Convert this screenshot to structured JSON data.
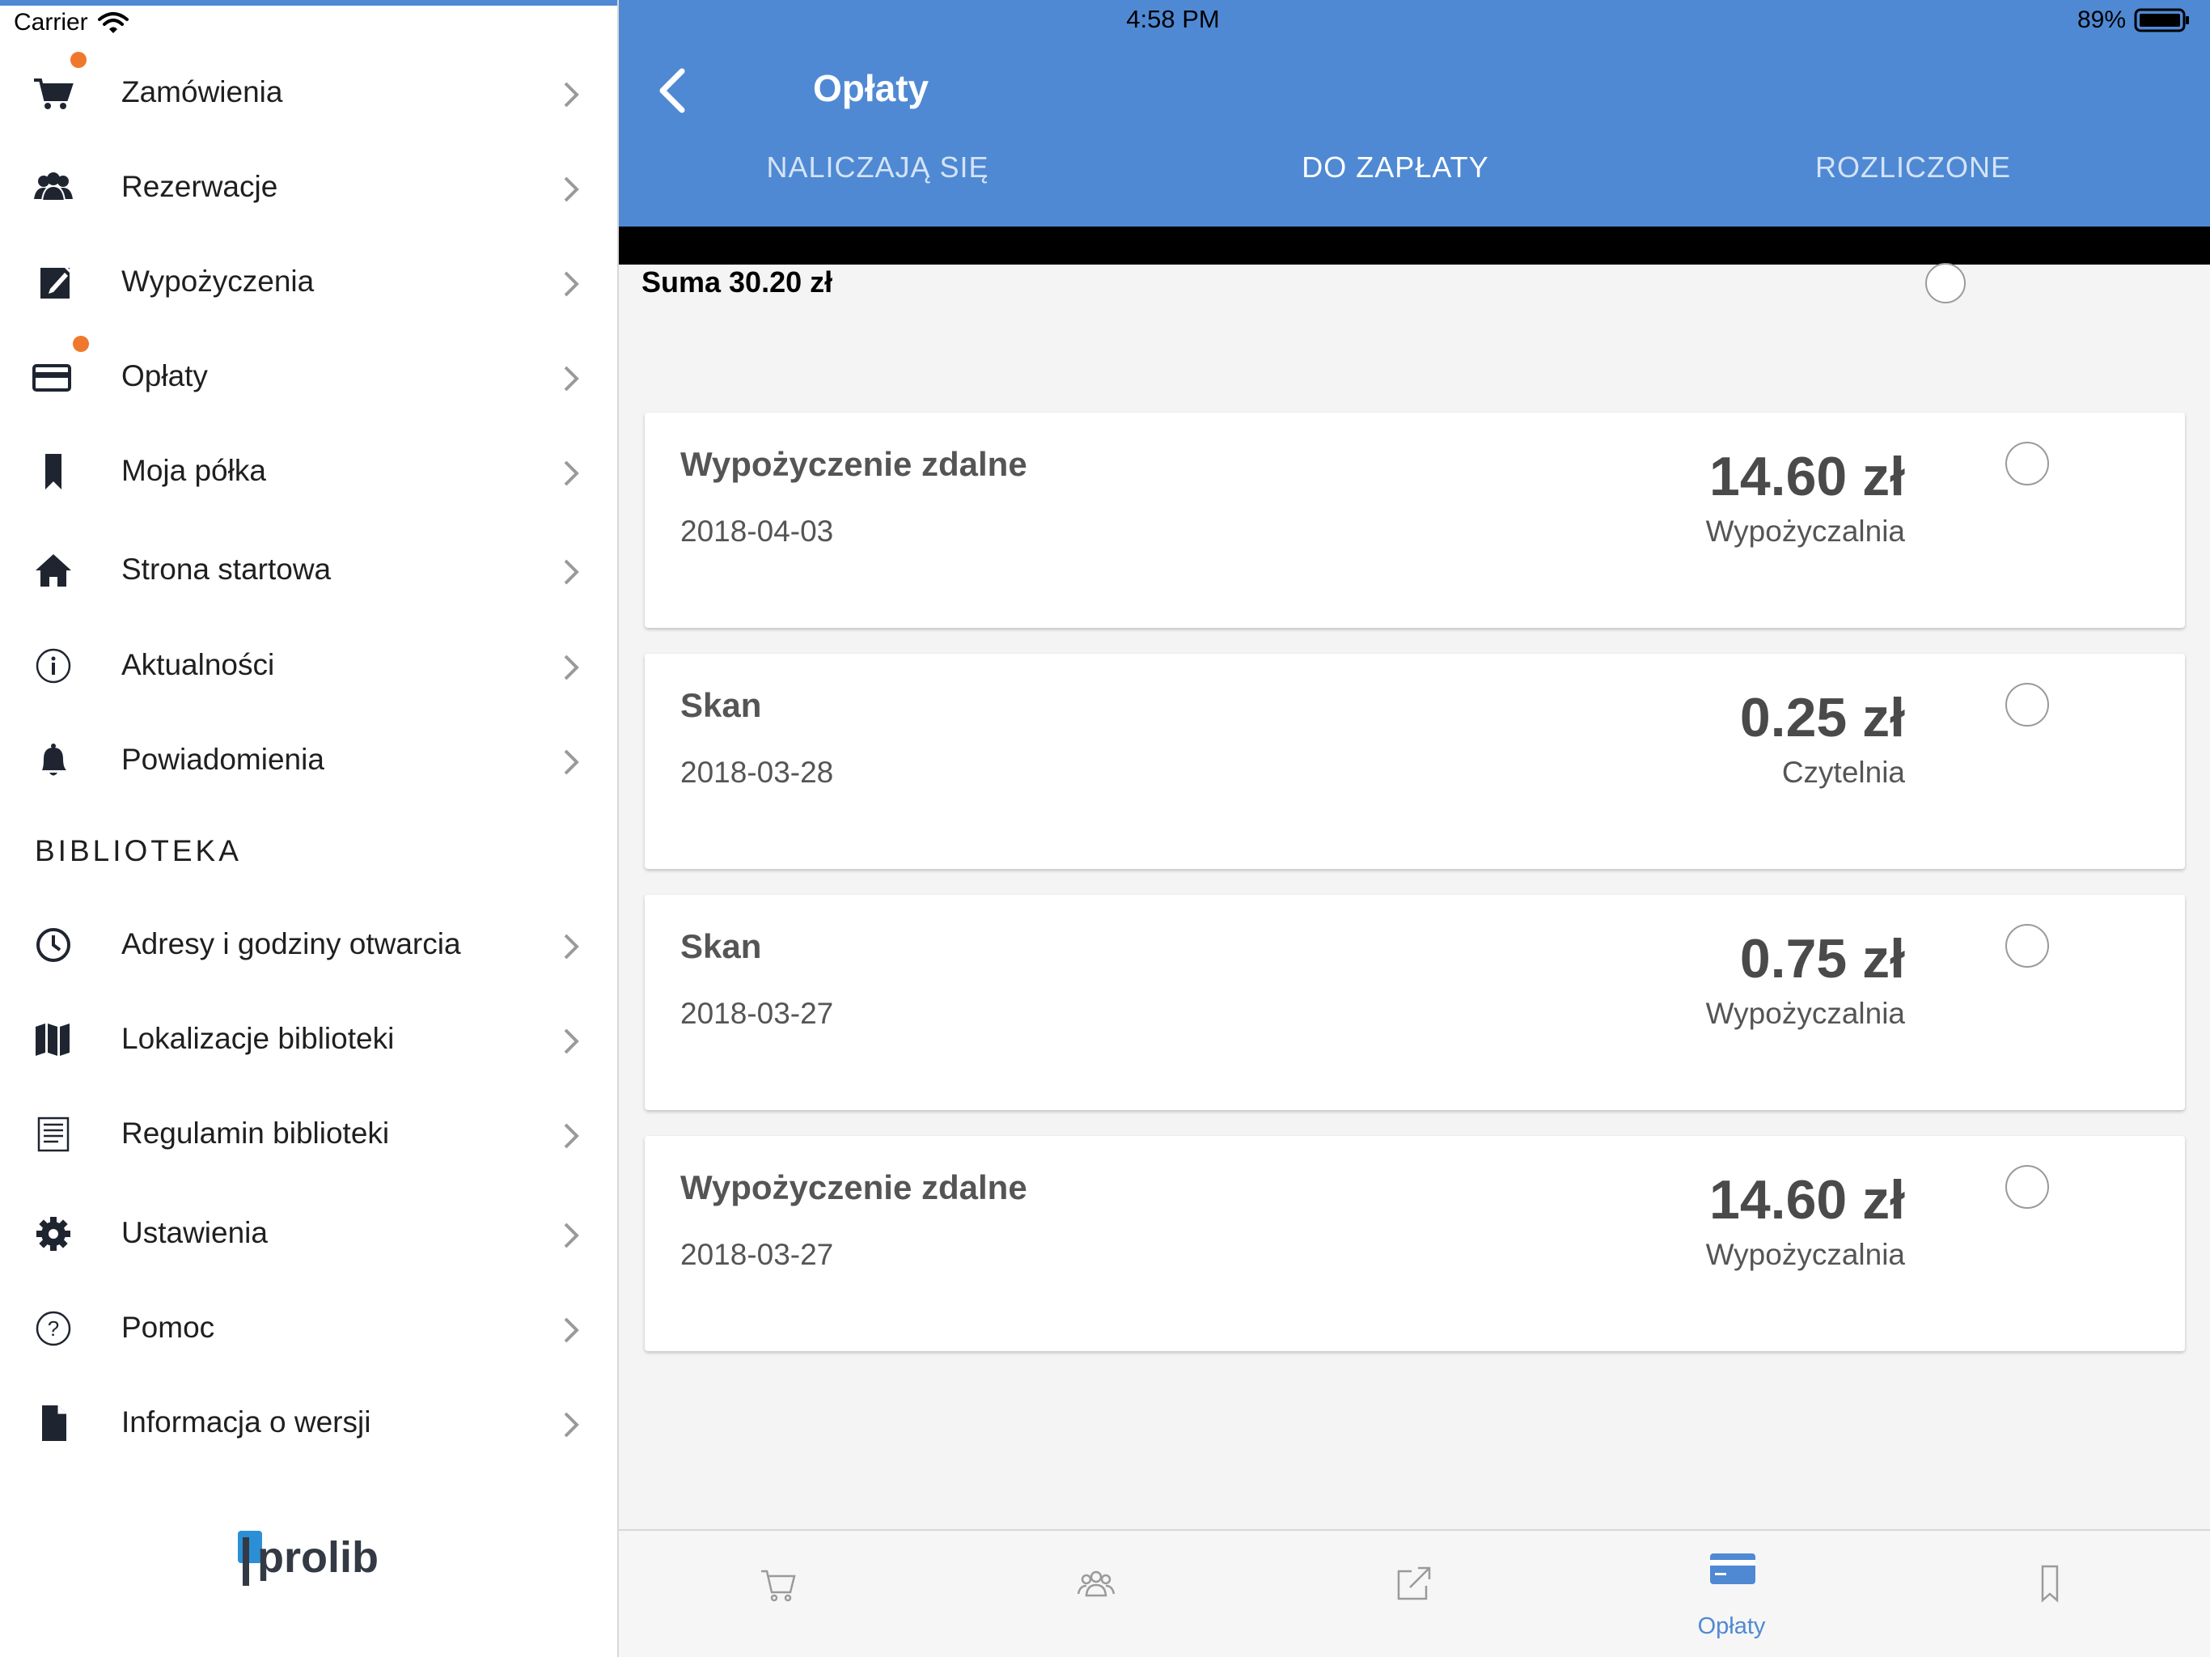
{
  "status_bar": {
    "carrier": "Carrier",
    "time": "4:58 PM",
    "battery": "89%"
  },
  "sidebar": {
    "items": [
      {
        "label": "Zamówienia",
        "icon": "cart-icon",
        "badge": true
      },
      {
        "label": "Rezerwacje",
        "icon": "people-icon",
        "badge": false
      },
      {
        "label": "Wypożyczenia",
        "icon": "edit-icon",
        "badge": false
      },
      {
        "label": "Opłaty",
        "icon": "credit-card-icon",
        "badge": true
      },
      {
        "label": "Moja półka",
        "icon": "bookmark-icon",
        "badge": false
      },
      {
        "label": "Strona startowa",
        "icon": "home-icon",
        "badge": false
      },
      {
        "label": "Aktualności",
        "icon": "info-icon",
        "badge": false
      },
      {
        "label": "Powiadomienia",
        "icon": "bell-icon",
        "badge": false
      }
    ],
    "section_title": "BIBLIOTEKA",
    "library_items": [
      {
        "label": "Adresy i godziny otwarcia",
        "icon": "clock-icon"
      },
      {
        "label": "Lokalizacje biblioteki",
        "icon": "map-icon"
      },
      {
        "label": "Regulamin biblioteki",
        "icon": "document-list-icon"
      },
      {
        "label": "Ustawienia",
        "icon": "gear-icon"
      },
      {
        "label": "Pomoc",
        "icon": "help-icon"
      },
      {
        "label": "Informacja o wersji",
        "icon": "file-icon"
      }
    ],
    "logo_text": "prolib"
  },
  "header": {
    "title": "Opłaty",
    "tabs": [
      {
        "label": "NALICZAJĄ SIĘ",
        "active": false
      },
      {
        "label": "DO ZAPŁATY",
        "active": true
      },
      {
        "label": "ROZLICZONE",
        "active": false
      }
    ]
  },
  "summary": {
    "label": "Suma 30.20 zł"
  },
  "fees": [
    {
      "title": "Wypożyczenie zdalne",
      "date": "2018-04-03",
      "amount": "14.60 zł",
      "place": "Wypożyczalnia"
    },
    {
      "title": "Skan",
      "date": "2018-03-28",
      "amount": "0.25 zł",
      "place": "Czytelnia"
    },
    {
      "title": "Skan",
      "date": "2018-03-27",
      "amount": "0.75 zł",
      "place": "Wypożyczalnia"
    },
    {
      "title": "Wypożyczenie zdalne",
      "date": "2018-03-27",
      "amount": "14.60 zł",
      "place": "Wypożyczalnia"
    }
  ],
  "tabbar": {
    "items": [
      {
        "icon": "cart-icon",
        "label": ""
      },
      {
        "icon": "people-icon",
        "label": ""
      },
      {
        "icon": "external-link-icon",
        "label": ""
      },
      {
        "icon": "credit-card-icon",
        "label": "Opłaty"
      },
      {
        "icon": "bookmark-icon",
        "label": ""
      }
    ]
  },
  "colors": {
    "accent": "#4f89d4",
    "badge": "#f0782d",
    "text": "#1f1f1f"
  }
}
